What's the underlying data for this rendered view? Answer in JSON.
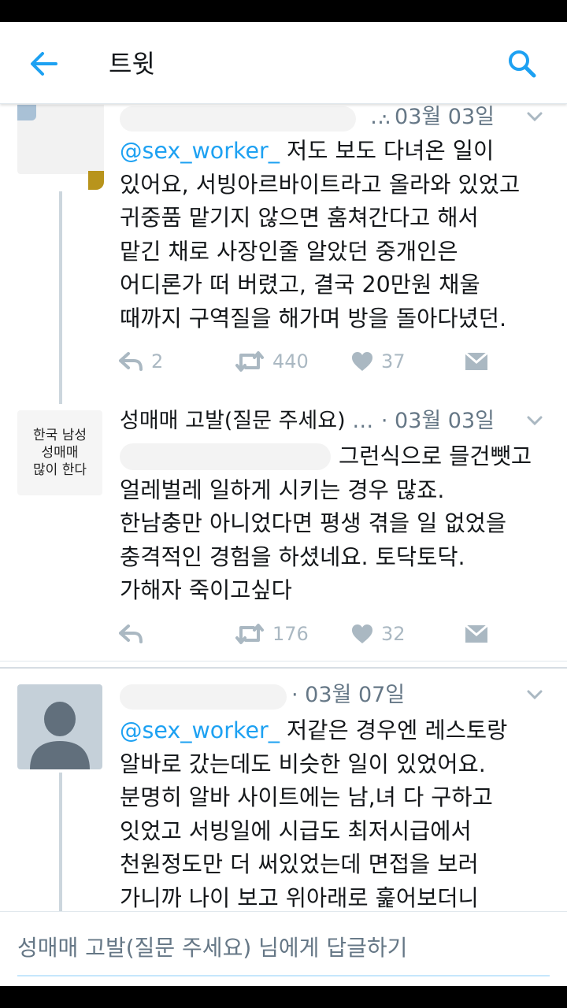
{
  "app_bar": {
    "title": "트윗"
  },
  "tweets": [
    {
      "name": "",
      "handle_dots": "…",
      "date": "· 03월 03일",
      "mention": "@sex_worker_",
      "lines": [
        " 저도 보도 다녀온 일이",
        "있어요, 서빙아르바이트라고 올라와 있었고",
        "귀중품 맡기지 않으면 훔쳐간다고 해서",
        "맡긴 채로 사장인줄 알았던 중개인은",
        "어디론가 떠 버렸고, 결국 20만원 채울",
        "때까지 구역질을 해가며 방을 돌아다녔던."
      ],
      "reply_count": "2",
      "retweet_count": "440",
      "like_count": "37"
    },
    {
      "avatar_text": [
        "한국 남성",
        "성매매",
        "많이 한다"
      ],
      "name": "성매매 고발(질문 주세요)",
      "handle_dots": "…",
      "date": "· 03월 03일",
      "lines": [
        "그런식으로 믈건뺏고",
        "얼레벌레 일하게 시키는 경우 많죠.",
        "한남충만 아니었다면 평생 겪을 일 없었을",
        "충격적인 경험을 하셨네요. 토닥토닥.",
        "가해자 죽이고싶다"
      ],
      "reply_count": "",
      "retweet_count": "176",
      "like_count": "32"
    },
    {
      "date": "· 03월 07일",
      "mention": "@sex_worker_",
      "lines": [
        " 저같은 경우엔 레스토랑",
        "알바로 갔는데도 비슷한 일이 있었어요.",
        "분명히 알바 사이트에는 남,녀 다 구하고",
        "잇었고 서빙일에 시급도 최저시급에서",
        "천원정도만 더 써있었는데 면접을 보러",
        "가니까 나이 보고 위아래로 훑어보더니"
      ]
    }
  ],
  "reply_bar": {
    "placeholder": "성매매 고발(질문 주세요) 님에게 답글하기"
  },
  "colors": {
    "accent": "#1da1f2",
    "icon_gray": "#aab8c2",
    "meta_gray": "#657786"
  },
  "icons": [
    "back-arrow-icon",
    "search-icon",
    "chevron-down-icon",
    "reply-icon",
    "retweet-icon",
    "heart-icon",
    "direct-message-icon"
  ]
}
